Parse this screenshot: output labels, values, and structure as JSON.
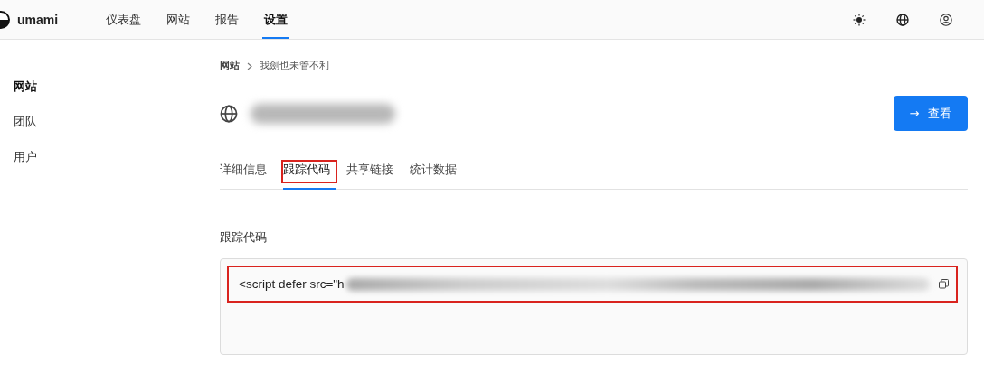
{
  "header": {
    "logo": "umami",
    "nav": [
      {
        "label": "仪表盘",
        "selected": false
      },
      {
        "label": "网站",
        "selected": false
      },
      {
        "label": "报告",
        "selected": false
      },
      {
        "label": "设置",
        "selected": true
      }
    ]
  },
  "sidebar": {
    "items": [
      {
        "label": "网站",
        "selected": true
      },
      {
        "label": "团队",
        "selected": false
      },
      {
        "label": "用户",
        "selected": false
      }
    ]
  },
  "breadcrumb": [
    "网站",
    "我劍也未管不利"
  ],
  "site": {
    "view_button": "查看",
    "view_arrow": "→"
  },
  "tabs": [
    {
      "label": "详细信息",
      "selected": false,
      "highlighted": false
    },
    {
      "label": "跟踪代码",
      "selected": true,
      "highlighted": true
    },
    {
      "label": "共享链接",
      "selected": false,
      "highlighted": false
    },
    {
      "label": "统计数据",
      "selected": false,
      "highlighted": false
    }
  ],
  "tracking": {
    "label": "跟踪代码",
    "code": "<script defer src=\"h",
    "highlighted": true
  }
}
